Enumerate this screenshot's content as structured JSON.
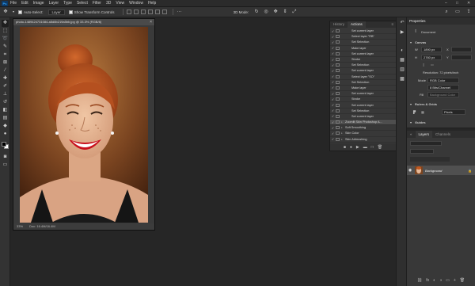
{
  "menubar": {
    "logo": "Ps",
    "items": [
      "File",
      "Edit",
      "Image",
      "Layer",
      "Type",
      "Select",
      "Filter",
      "3D",
      "View",
      "Window",
      "Help"
    ],
    "window_controls": [
      "–",
      "□",
      "✕"
    ]
  },
  "options_bar": {
    "auto_select_label": "Auto-Select:",
    "auto_select_value": "Layer",
    "show_transform_label": "Show Transform Controls",
    "mode_3d_label": "3D Mode:"
  },
  "document": {
    "tab_title": "photo-1489424731084-a5d8b219a5bb.jpg @ 33.3% (RGB/8)",
    "close_glyph": "×",
    "zoom": "33%",
    "doc_size": "Doc: 16.4M/16.4M"
  },
  "actions_panel": {
    "tabs": [
      "History",
      "Actions"
    ],
    "active_tab": "Actions",
    "rows": [
      {
        "label": "Set current layer",
        "indent": 1,
        "selected": false
      },
      {
        "label": "Select layer \"RB\"",
        "indent": 1,
        "selected": false
      },
      {
        "label": "Set Selection",
        "indent": 1,
        "selected": false
      },
      {
        "label": "Make layer",
        "indent": 1,
        "selected": false
      },
      {
        "label": "Set current layer",
        "indent": 1,
        "selected": false
      },
      {
        "label": "Stroke",
        "indent": 1,
        "selected": false
      },
      {
        "label": "Set Selection",
        "indent": 1,
        "selected": false
      },
      {
        "label": "Set current layer",
        "indent": 1,
        "selected": false
      },
      {
        "label": "Select layer \"SO\"",
        "indent": 1,
        "selected": false
      },
      {
        "label": "Set Selection",
        "indent": 1,
        "selected": false
      },
      {
        "label": "Make layer",
        "indent": 1,
        "selected": false
      },
      {
        "label": "Set current layer",
        "indent": 1,
        "selected": false
      },
      {
        "label": "Stroke",
        "indent": 1,
        "selected": false
      },
      {
        "label": "Set current layer",
        "indent": 1,
        "selected": false
      },
      {
        "label": "Set Selection",
        "indent": 1,
        "selected": false
      },
      {
        "label": "Set current layer",
        "indent": 1,
        "selected": false
      },
      {
        "label": "Zoomlit Skin Photoshop A...",
        "indent": 0,
        "selected": true
      },
      {
        "label": "Soft Smoothing",
        "indent": 0,
        "selected": false
      },
      {
        "label": "Skin Color",
        "indent": 0,
        "selected": false
      },
      {
        "label": "Skin Airbrushing",
        "indent": 0,
        "selected": false
      },
      {
        "label": "New Skin",
        "indent": 0,
        "selected": false
      }
    ],
    "footer_icons": [
      "■",
      "●",
      "▶",
      "▬",
      "□",
      "🗑"
    ]
  },
  "properties_panel": {
    "title": "Properties",
    "section": "Document",
    "canvas_heading": "Canvas",
    "width_label": "W",
    "width_value": "1890 px",
    "height_label": "H",
    "height_value": "2760 px",
    "x_label": "X",
    "y_label": "Y",
    "resolution": "Resolution: 72 pixels/inch",
    "mode_label": "Mode",
    "mode_value": "RGB Color",
    "depth_value": "8 Bits/Channel",
    "fill_label": "Fill",
    "fill_value": "Background Color",
    "rulers_heading": "Rulers & Grids",
    "units_value": "Pixels",
    "guides_heading": "Guides"
  },
  "layers_panel": {
    "tabs": [
      "Layers",
      "Channels"
    ],
    "active_tab": "Layers",
    "layer_name": "Background",
    "footer_icons": [
      "⛓",
      "fx",
      "◐",
      "◑",
      "▭",
      "+",
      "🗑"
    ]
  },
  "colors": {
    "foreground": "#000000",
    "background": "#ffffff",
    "lipstick": "#c8101c",
    "hair": "#b5501f"
  }
}
